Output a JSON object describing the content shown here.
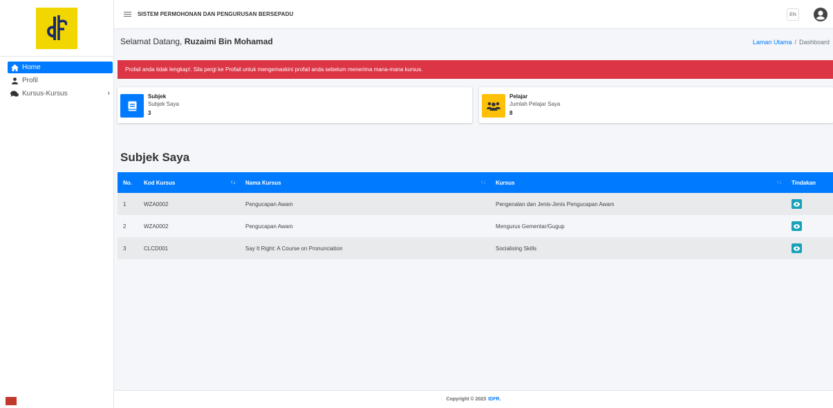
{
  "app": {
    "system_title": "SISTEM PERMOHONAN DAN PENGURUSAN BERSEPADU",
    "language": "EN"
  },
  "sidebar": {
    "items": [
      {
        "label": "Home",
        "icon": "home-icon",
        "active": true
      },
      {
        "label": "Profil",
        "icon": "user-icon"
      },
      {
        "label": "Kursus-Kursus",
        "icon": "comments-icon"
      }
    ],
    "chevron": "›"
  },
  "header": {
    "welcome_prefix": "Selamat Datang, ",
    "user_name": "Ruzaimi Bin Mohamad",
    "breadcrumb": {
      "home": "Laman Utama",
      "separator": "/",
      "current": "Dashboard"
    }
  },
  "alert": {
    "text": "Profail anda tidak lengkap!. Sila pergi ke Profail untuk mengemaskini profail anda sebelum menerima mana-mana kursus."
  },
  "cards": [
    {
      "title": "Subjek",
      "subtitle": "Subjek Saya",
      "value": "3",
      "color": "#007bff",
      "icon": "book-icon"
    },
    {
      "title": "Pelajar",
      "subtitle": "Jumlah Pelajar Saya",
      "value": "8",
      "color": "#ffc107",
      "icon": "users-icon"
    }
  ],
  "section": {
    "title": "Subjek Saya"
  },
  "table": {
    "headers": {
      "no": "No.",
      "kod": "Kod Kursus",
      "nama": "Nama Kursus",
      "kursus": "Kursus",
      "tindakan": "Tindakan"
    },
    "rows": [
      {
        "no": "1",
        "kod": "WZA0002",
        "nama": "Pengucapan Awam",
        "kursus": "Pengenalan dan Jenis-Jenis Pengucapan Awam"
      },
      {
        "no": "2",
        "kod": "WZA0002",
        "nama": "Pengucapan Awam",
        "kursus": "Mengurus Gementar/Gugup"
      },
      {
        "no": "3",
        "kod": "CLCD001",
        "nama": "Say It Right: A Course on Pronunciation",
        "kursus": "Socialising Skills"
      }
    ]
  },
  "footer": {
    "text": "Copyright © 2023",
    "brand": "IDFR",
    "suffix": "."
  },
  "colors": {
    "primary": "#007bff",
    "danger": "#dc3545",
    "warning": "#ffc107",
    "info": "#17a2b8",
    "logo": "#f2d600"
  }
}
